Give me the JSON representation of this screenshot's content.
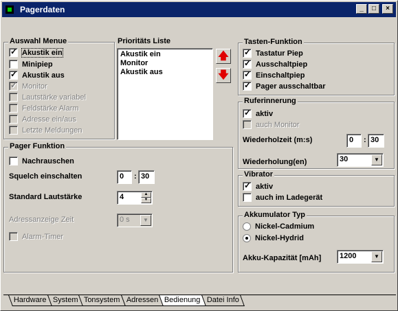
{
  "window": {
    "title": "Pagerdaten"
  },
  "auswahl": {
    "title": "Auswahl Menue",
    "items": [
      {
        "label": "Akustik ein",
        "checked": true,
        "enabled": true
      },
      {
        "label": "Minipiep",
        "checked": false,
        "enabled": true
      },
      {
        "label": "Akustik aus",
        "checked": true,
        "enabled": true
      },
      {
        "label": "Monitor",
        "checked": true,
        "enabled": false
      },
      {
        "label": "Lautstärke variabel",
        "checked": false,
        "enabled": false
      },
      {
        "label": "Feldstärke Alarm",
        "checked": false,
        "enabled": false
      },
      {
        "label": "Adresse ein/aus",
        "checked": false,
        "enabled": false
      },
      {
        "label": "Letzte Meldungen",
        "checked": false,
        "enabled": false
      }
    ]
  },
  "prioritaet": {
    "title": "Prioritäts Liste",
    "items": [
      "Akustik ein",
      "Monitor",
      "Akustik aus"
    ],
    "up_icon": "arrow-up-icon",
    "down_icon": "arrow-down-icon"
  },
  "pager": {
    "title": "Pager Funktion",
    "nachrauschen": "Nachrauschen",
    "squelch_label": "Squelch einschalten",
    "squelch_min": "0",
    "squelch_sec": "30",
    "lautstaerke_label": "Standard Lautstärke",
    "lautstaerke_value": "4",
    "adress_label": "Adressanzeige Zeit",
    "adress_value": "0 s",
    "alarm_timer": "Alarm-Timer"
  },
  "tasten": {
    "title": "Tasten-Funktion",
    "items": [
      {
        "label": "Tastatur Piep",
        "checked": true
      },
      {
        "label": "Ausschaltpiep",
        "checked": true
      },
      {
        "label": "Einschaltpiep",
        "checked": true
      },
      {
        "label": "Pager ausschaltbar",
        "checked": true
      }
    ]
  },
  "ruf": {
    "title": "Ruferinnerung",
    "aktiv": "aktiv",
    "auch_monitor": "auch Monitor",
    "wiederholzeit_label": "Wiederholzeit (m:s)",
    "wiederholzeit_min": "0",
    "wiederholzeit_sec": "30",
    "wiederholung_label": "Wiederholung(en)",
    "wiederholung_value": "30"
  },
  "vibrator": {
    "title": "Vibrator",
    "aktiv": "aktiv",
    "ladegeraet": "auch im Ladegerät"
  },
  "akku": {
    "title": "Akkumulator Typ",
    "nicd": "Nickel-Cadmium",
    "nimh": "Nickel-Hydrid",
    "kapazitaet_label": "Akku-Kapazität [mAh]",
    "kapazitaet_value": "1200"
  },
  "tabs": [
    "Hardware",
    "System",
    "Tonsystem",
    "Adressen",
    "Bedienung",
    "Datei Info"
  ],
  "active_tab": "Bedienung"
}
